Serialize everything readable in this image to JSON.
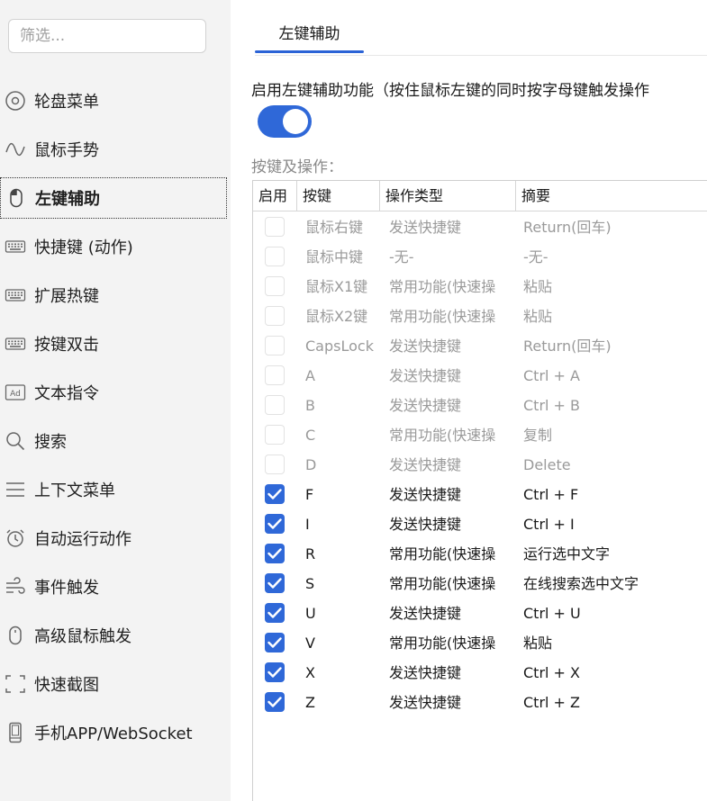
{
  "sidebar": {
    "filter_placeholder": "筛选...",
    "items": [
      {
        "label": "轮盘菜单",
        "icon": "wheel-menu-icon"
      },
      {
        "label": "鼠标手势",
        "icon": "gesture-icon"
      },
      {
        "label": "左键辅助",
        "icon": "mouse-icon"
      },
      {
        "label": "快捷键 (动作)",
        "icon": "keyboard-icon"
      },
      {
        "label": "扩展热键",
        "icon": "keyboard-icon"
      },
      {
        "label": "按键双击",
        "icon": "keyboard-icon"
      },
      {
        "label": "文本指令",
        "icon": "ad-text-icon"
      },
      {
        "label": "搜索",
        "icon": "search-icon"
      },
      {
        "label": "上下文菜单",
        "icon": "menu-lines-icon"
      },
      {
        "label": "自动运行动作",
        "icon": "alarm-clock-icon"
      },
      {
        "label": "事件触发",
        "icon": "wind-icon"
      },
      {
        "label": "高级鼠标触发",
        "icon": "mouse-outline-icon"
      },
      {
        "label": "快速截图",
        "icon": "screenshot-frame-icon"
      },
      {
        "label": "手机APP/WebSocket",
        "icon": "phone-icon"
      }
    ],
    "active_index": 2
  },
  "main": {
    "tab_label": "左键辅助",
    "enable_label": "启用左键辅助功能（按住鼠标左键的同时按字母键触发操作",
    "enable_on": true,
    "section_label": "按键及操作：",
    "columns": [
      "启用",
      "按键",
      "操作类型",
      "摘要"
    ],
    "rows": [
      {
        "enabled": false,
        "key": "鼠标右键",
        "type": "发送快捷键",
        "summary": "Return(回车)"
      },
      {
        "enabled": false,
        "key": "鼠标中键",
        "type": "-无-",
        "summary": "-无-"
      },
      {
        "enabled": false,
        "key": "鼠标X1键",
        "type": "常用功能(快速操",
        "summary": "粘贴"
      },
      {
        "enabled": false,
        "key": "鼠标X2键",
        "type": "常用功能(快速操",
        "summary": "粘贴"
      },
      {
        "enabled": false,
        "key": "CapsLock",
        "type": "发送快捷键",
        "summary": "Return(回车)"
      },
      {
        "enabled": false,
        "key": "A",
        "type": "发送快捷键",
        "summary": "Ctrl + A"
      },
      {
        "enabled": false,
        "key": "B",
        "type": "发送快捷键",
        "summary": "Ctrl + B"
      },
      {
        "enabled": false,
        "key": "C",
        "type": "常用功能(快速操",
        "summary": "复制"
      },
      {
        "enabled": false,
        "key": "D",
        "type": "发送快捷键",
        "summary": "Delete"
      },
      {
        "enabled": true,
        "key": "F",
        "type": "发送快捷键",
        "summary": "Ctrl + F"
      },
      {
        "enabled": true,
        "key": "I",
        "type": "发送快捷键",
        "summary": "Ctrl + I"
      },
      {
        "enabled": true,
        "key": "R",
        "type": "常用功能(快速操",
        "summary": "运行选中文字"
      },
      {
        "enabled": true,
        "key": "S",
        "type": "常用功能(快速操",
        "summary": "在线搜索选中文字"
      },
      {
        "enabled": true,
        "key": "U",
        "type": "发送快捷键",
        "summary": "Ctrl + U"
      },
      {
        "enabled": true,
        "key": "V",
        "type": "常用功能(快速操",
        "summary": "粘贴"
      },
      {
        "enabled": true,
        "key": "X",
        "type": "发送快捷键",
        "summary": "Ctrl + X"
      },
      {
        "enabled": true,
        "key": "Z",
        "type": "发送快捷键",
        "summary": "Ctrl + Z"
      }
    ]
  },
  "colors": {
    "accent": "#2f68d8",
    "sidebar_bg": "#f3f3f3",
    "disabled_text": "#9a9a9a"
  }
}
